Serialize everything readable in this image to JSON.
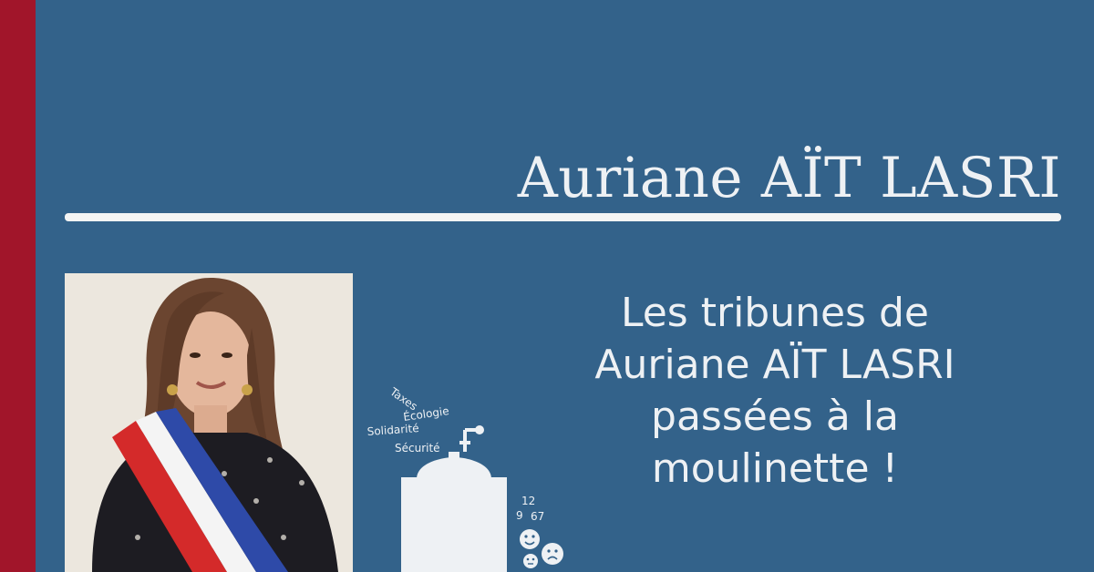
{
  "title": "Auriane AÏT LASRI",
  "subtitle": {
    "line1": "Les tribunes de",
    "line2": "Auriane AÏT LASRI",
    "line3": "passées à la",
    "line4": "moulinette !"
  },
  "illustration": {
    "words": [
      "Taxes",
      "Écologie",
      "Solidarité",
      "Sécurité"
    ],
    "numbers": [
      "12",
      "9",
      "67"
    ],
    "icons": [
      "coffee-grinder-icon",
      "happy-face-icon",
      "neutral-face-icon",
      "sad-face-icon"
    ]
  },
  "colors": {
    "background": "#33628a",
    "accent_red": "#a1152a",
    "text": "#eef1f4"
  }
}
